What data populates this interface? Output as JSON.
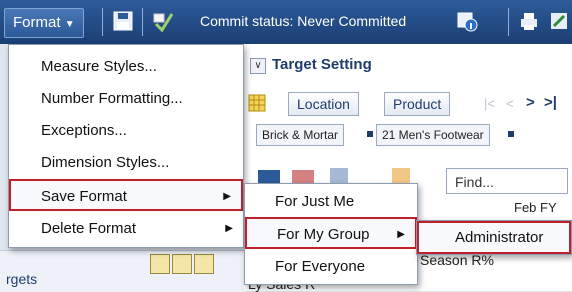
{
  "toolbar": {
    "format_label": "Format",
    "commit_status": "Commit status: Never Committed"
  },
  "panel": {
    "title": "Target Setting",
    "pills": [
      "Location",
      "Product"
    ],
    "crumbs": [
      "Brick & Mortar",
      "21 Men's Footwear"
    ],
    "find_placeholder": "Find...",
    "col1": "Feb FY",
    "col2": "Season R%",
    "row1": "Ly Sales R"
  },
  "left": {
    "label": "rgets"
  },
  "format_menu": {
    "items": [
      {
        "label": "Measure Styles..."
      },
      {
        "label": "Number Formatting..."
      },
      {
        "label": "Exceptions..."
      },
      {
        "label": "Dimension Styles..."
      },
      {
        "label": "Save Format"
      },
      {
        "label": "Delete Format"
      }
    ]
  },
  "save_submenu": {
    "items": [
      {
        "label": "For Just Me"
      },
      {
        "label": "For My Group"
      },
      {
        "label": "For Everyone"
      }
    ]
  },
  "group_submenu": {
    "items": [
      {
        "label": "Administrator"
      }
    ]
  }
}
